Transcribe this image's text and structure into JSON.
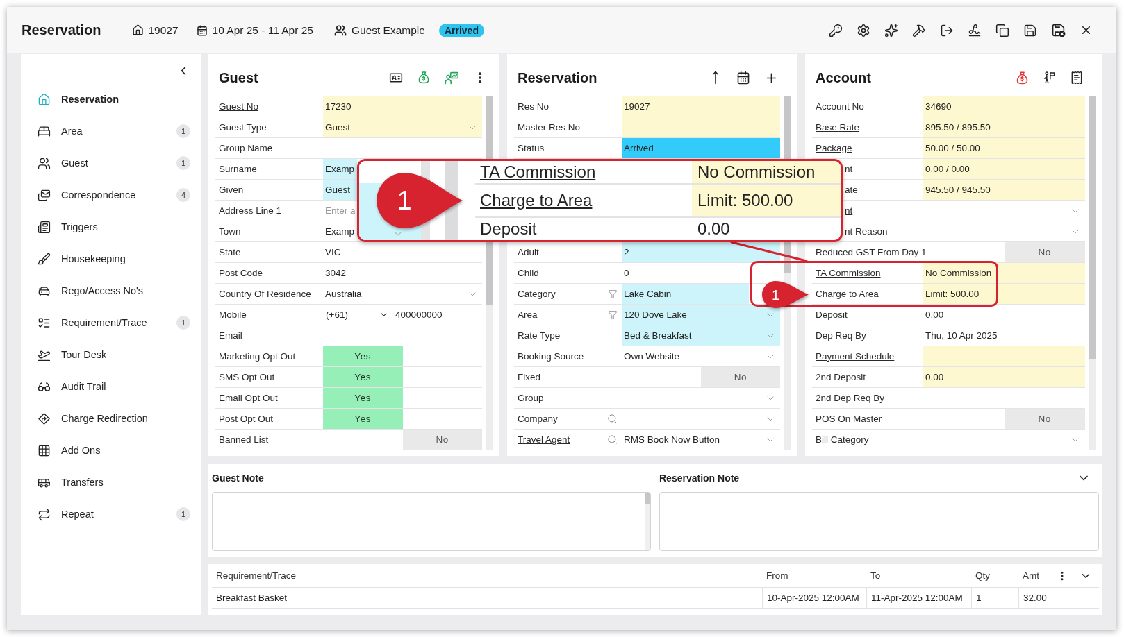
{
  "window": {
    "title": "Reservation",
    "reservation_no": "19027",
    "dates": "10 Apr 25 - 11 Apr 25",
    "guest_name": "Guest Example",
    "status": "Arrived"
  },
  "sidebar": {
    "items": [
      {
        "label": "Reservation",
        "selected": true
      },
      {
        "label": "Area",
        "selected": false,
        "badge": "1"
      },
      {
        "label": "Guest",
        "selected": false,
        "badge": "1"
      },
      {
        "label": "Correspondence",
        "selected": false,
        "badge": "4"
      },
      {
        "label": "Triggers",
        "selected": false
      },
      {
        "label": "Housekeeping",
        "selected": false
      },
      {
        "label": "Rego/Access No's",
        "selected": false
      },
      {
        "label": "Requirement/Trace",
        "selected": false,
        "badge": "1"
      },
      {
        "label": "Tour Desk",
        "selected": false
      },
      {
        "label": "Audit Trail",
        "selected": false
      },
      {
        "label": "Charge Redirection",
        "selected": false
      },
      {
        "label": "Add Ons",
        "selected": false
      },
      {
        "label": "Transfers",
        "selected": false
      },
      {
        "label": "Repeat",
        "selected": false,
        "badge": "1"
      }
    ]
  },
  "guest": {
    "title": "Guest",
    "fields": [
      {
        "kind": "field",
        "label": "Guest No",
        "link": true,
        "dropdown": false,
        "value": "17230",
        "color": "#fef8d0"
      },
      {
        "kind": "field",
        "label": "Guest Type",
        "link": false,
        "dropdown": true,
        "value": "Guest",
        "color": "#fef8d0"
      },
      {
        "kind": "field",
        "label": "Group Name",
        "link": false,
        "dropdown": false
      },
      {
        "kind": "field",
        "label": "Surname",
        "link": false,
        "dropdown": false,
        "value": "Examp",
        "color": "#cdf4fa"
      },
      {
        "kind": "field",
        "label": "Given",
        "link": false,
        "dropdown": false,
        "value": "Guest",
        "color": "#cdf4fa"
      },
      {
        "kind": "field",
        "label": "Address Line 1",
        "link": false,
        "dropdown": false,
        "placeholder": "Enter a"
      },
      {
        "kind": "field",
        "label": "Town",
        "link": false,
        "dropdown": false,
        "value": "Examp"
      },
      {
        "kind": "field",
        "label": "State",
        "link": false,
        "dropdown": false,
        "value": "VIC"
      },
      {
        "kind": "field",
        "label": "Post Code",
        "link": false,
        "dropdown": false,
        "value": "3042"
      },
      {
        "kind": "field",
        "label": "Country Of Residence",
        "link": false,
        "dropdown": true,
        "value": "Australia"
      },
      {
        "kind": "phone",
        "label": "Mobile",
        "link": false,
        "code": "(+61)",
        "number": "400000000"
      },
      {
        "kind": "field",
        "label": "Email",
        "link": false,
        "dropdown": false
      },
      {
        "kind": "toggle",
        "label": "Marketing Opt Out",
        "link": false,
        "value": "Yes",
        "on": true
      },
      {
        "kind": "toggle",
        "label": "SMS Opt Out",
        "link": false,
        "value": "Yes",
        "on": true
      },
      {
        "kind": "toggle",
        "label": "Email Opt Out",
        "link": false,
        "value": "Yes",
        "on": true
      },
      {
        "kind": "toggle",
        "label": "Post Opt Out",
        "link": false,
        "value": "Yes",
        "on": true
      },
      {
        "kind": "toggle",
        "label": "Banned List",
        "link": false,
        "value": "No",
        "on": false
      }
    ]
  },
  "reservation": {
    "title": "Reservation",
    "fields_upper": [
      {
        "kind": "field",
        "label": "Res No",
        "link": false,
        "dropdown": false,
        "value": "19027",
        "color": "#fef8d0"
      },
      {
        "kind": "field",
        "label": "Master Res No",
        "link": false,
        "dropdown": false,
        "color": "#fef8d0"
      },
      {
        "kind": "field",
        "label": "Status",
        "link": false,
        "dropdown": false,
        "value": "Arrived",
        "color": "#33ccfa"
      }
    ],
    "fields_lower": [
      {
        "kind": "field",
        "label": "Adult",
        "link": false,
        "dropdown": false,
        "value": "2",
        "color": "#cdf4fa"
      },
      {
        "kind": "field",
        "label": "Child",
        "link": false,
        "dropdown": false,
        "value": "0"
      },
      {
        "kind": "filtered",
        "label": "Category",
        "link": false,
        "dropdown": false,
        "value": "Lake Cabin",
        "color": "#cdf4fa"
      },
      {
        "kind": "filtered",
        "label": "Area",
        "link": false,
        "dropdown": true,
        "value": "120 Dove Lake",
        "color": "#cdf4fa"
      },
      {
        "kind": "field",
        "label": "Rate Type",
        "link": false,
        "dropdown": true,
        "value": "Bed & Breakfast",
        "color": "#cdf4fa"
      },
      {
        "kind": "field",
        "label": "Booking Source",
        "link": false,
        "dropdown": true,
        "value": "Own Website"
      },
      {
        "kind": "toggle",
        "label": "Fixed",
        "link": false,
        "value": "No",
        "on": false
      },
      {
        "kind": "field",
        "label": "Group",
        "link": true,
        "dropdown": true
      },
      {
        "kind": "lookup",
        "label": "Company",
        "link": true,
        "dropdown": true
      },
      {
        "kind": "lookup",
        "label": "Travel Agent",
        "link": true,
        "dropdown": true,
        "value": "RMS Book Now Button"
      }
    ]
  },
  "account": {
    "title": "Account",
    "fields": [
      {
        "kind": "field",
        "label": "Account No",
        "link": false,
        "dropdown": false,
        "value": "34690",
        "color": "#fef8d0"
      },
      {
        "kind": "field",
        "label": "Base Rate",
        "link": true,
        "dropdown": false,
        "value": "895.50 / 895.50",
        "color": "#fef8d0"
      },
      {
        "kind": "field",
        "label": "Package",
        "link": true,
        "dropdown": false,
        "value": "50.00 / 50.00",
        "color": "#fef8d0"
      },
      {
        "kind": "field",
        "label": "nt",
        "link": false,
        "dropdown": false,
        "value": "0.00 / 0.00",
        "color": "#fef8d0"
      },
      {
        "kind": "field",
        "label": "ate",
        "link": true,
        "dropdown": false,
        "value": "945.50 / 945.50",
        "color": "#fef8d0"
      },
      {
        "kind": "field",
        "label": "nt",
        "link": true,
        "dropdown": true
      },
      {
        "kind": "field",
        "label": "nt Reason",
        "link": false,
        "dropdown": true
      },
      {
        "kind": "toggle",
        "label": "Reduced GST From Day 1",
        "link": false,
        "value": "No",
        "on": false
      },
      {
        "kind": "field",
        "label": "TA Commission",
        "link": true,
        "dropdown": false,
        "value": "No Commission",
        "color": "#fef8d0"
      },
      {
        "kind": "field",
        "label": "Charge to Area",
        "link": true,
        "dropdown": false,
        "value": "Limit: 500.00",
        "color": "#fef8d0"
      },
      {
        "kind": "field",
        "label": "Deposit",
        "link": false,
        "dropdown": false,
        "value": "0.00"
      },
      {
        "kind": "field",
        "label": "Dep Req By",
        "link": false,
        "dropdown": false,
        "value": "Thu, 10 Apr 2025"
      },
      {
        "kind": "field",
        "label": "Payment Schedule",
        "link": true,
        "dropdown": false,
        "color": "#fef8d0"
      },
      {
        "kind": "field",
        "label": "2nd Deposit",
        "link": false,
        "dropdown": false,
        "value": "0.00",
        "color": "#fef8d0"
      },
      {
        "kind": "field",
        "label": "2nd Dep Req By",
        "link": false,
        "dropdown": false
      },
      {
        "kind": "toggle",
        "label": "POS On Master",
        "link": false,
        "value": "No",
        "on": false
      },
      {
        "kind": "field",
        "label": "Bill Category",
        "link": false,
        "dropdown": true
      }
    ]
  },
  "notes": {
    "guest_note": {
      "title": "Guest Note"
    },
    "reservation_note": {
      "title": "Reservation Note"
    }
  },
  "requirements": {
    "columns": [
      "Requirement/Trace",
      "From",
      "To",
      "Qty",
      "Amt"
    ],
    "rows": [
      [
        "Breakfast Basket",
        "10-Apr-2025 12:00AM",
        "11-Apr-2025 12:00AM",
        "1",
        "32.00"
      ]
    ]
  },
  "magnifier": {
    "marker": "1",
    "rows": [
      {
        "label": "TA Commission",
        "value": "No Commission",
        "link": true,
        "color": "#fef8d0"
      },
      {
        "label": "Charge to Area",
        "value": "Limit: 500.00",
        "link": true,
        "color": "#fef8d0"
      },
      {
        "label": "Deposit",
        "value": "0.00",
        "link": false
      }
    ]
  },
  "highlight": {
    "marker": "1"
  }
}
